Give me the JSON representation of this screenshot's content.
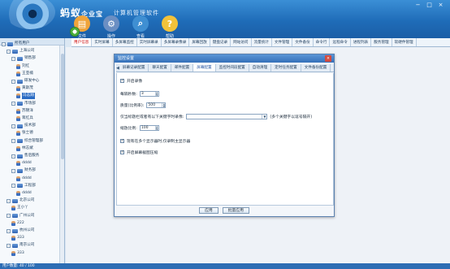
{
  "app": {
    "title": "蚂蚁企业宝",
    "title_suffix": "企业宝",
    "title_main": "蚂蚁",
    "subtitle": "计算机管理软件",
    "window_buttons": [
      "−",
      "□",
      "×"
    ]
  },
  "toolbar": {
    "items": [
      {
        "label": "文件",
        "icon": "folder-icon",
        "color": "#f0a43a"
      },
      {
        "label": "操作",
        "icon": "gear-icon",
        "color": "#6b8fc3"
      },
      {
        "label": "查看",
        "icon": "magnifier-icon",
        "color": "#3f8fd2"
      },
      {
        "label": "帮助",
        "icon": "help-icon",
        "color": "#f2c23a"
      }
    ]
  },
  "navbar": {
    "tabs": [
      "用户信息",
      "实时屏幕",
      "多屏幕监控",
      "实时屏幕录",
      "多屏幕录像录",
      "屏幕回放",
      "键盘记录",
      "网站访问",
      "流量统计",
      "文件管理",
      "文件备份",
      "命令行",
      "远程命令",
      "进程列表",
      "服务管理",
      "软硬件管理"
    ],
    "active_index": 0
  },
  "tree": {
    "nodes": [
      {
        "label": "所有用户",
        "type": "folder",
        "level": 0,
        "toggle": "-"
      },
      {
        "label": "上海公司",
        "type": "folder",
        "level": 1,
        "toggle": "-"
      },
      {
        "label": "销售部",
        "type": "folder",
        "level": 2,
        "toggle": "-"
      },
      {
        "label": "刘红",
        "type": "user",
        "level": 3
      },
      {
        "label": "王亚楠",
        "type": "user",
        "level": 3
      },
      {
        "label": "研发中心",
        "type": "folder",
        "level": 2,
        "toggle": "-"
      },
      {
        "label": "黄斯茂",
        "type": "user",
        "level": 3
      },
      {
        "label": "冯志翔",
        "type": "user",
        "level": 3,
        "selected": true
      },
      {
        "label": "市场部",
        "type": "folder",
        "level": 2,
        "toggle": "-"
      },
      {
        "label": "苏锦洋",
        "type": "user",
        "level": 3
      },
      {
        "label": "蒋红兵",
        "type": "user",
        "level": 3
      },
      {
        "label": "技术部",
        "type": "folder",
        "level": 2,
        "toggle": "-"
      },
      {
        "label": "张士德",
        "type": "user",
        "level": 3
      },
      {
        "label": "综合管理部",
        "type": "folder",
        "level": 2,
        "toggle": "-"
      },
      {
        "label": "林志斌",
        "type": "user",
        "level": 3
      },
      {
        "label": "售后服务",
        "type": "folder",
        "level": 2,
        "toggle": "-"
      },
      {
        "label": "dddd",
        "type": "user",
        "level": 3
      },
      {
        "label": "财务部",
        "type": "folder",
        "level": 2,
        "toggle": "-"
      },
      {
        "label": "dddd",
        "type": "user",
        "level": 3
      },
      {
        "label": "工程部",
        "type": "folder",
        "level": 2,
        "toggle": "-"
      },
      {
        "label": "dddd",
        "type": "user",
        "level": 3
      },
      {
        "label": "北京公司",
        "type": "folder",
        "level": 1,
        "toggle": "-"
      },
      {
        "label": "王小丫",
        "type": "user",
        "level": 2
      },
      {
        "label": "广州公司",
        "type": "folder",
        "level": 1,
        "toggle": "-"
      },
      {
        "label": "222",
        "type": "user",
        "level": 2
      },
      {
        "label": "杭州公司",
        "type": "folder",
        "level": 1,
        "toggle": "-"
      },
      {
        "label": "333",
        "type": "user",
        "level": 2
      },
      {
        "label": "南京公司",
        "type": "folder",
        "level": 1,
        "toggle": "-"
      },
      {
        "label": "333",
        "type": "user",
        "level": 2
      }
    ]
  },
  "status": {
    "text": "用户数量: 40 / 100"
  },
  "dialog": {
    "title": "监控设置",
    "close": "×",
    "tab_left": "◀",
    "tab_right": "▶",
    "tabs": [
      "屏幕记录配置",
      "聊天配置",
      "邮件配置",
      "屏幕配置",
      "监控时间段配置",
      "自动清理",
      "定时任务配置",
      "文件备份配置",
      "文件"
    ],
    "active_tab": 3,
    "enable_label": "开启录像",
    "enable_checked": "✓",
    "interval_label": "每隔秒数:",
    "interval_value": "3",
    "quality_label": "质量(比例率):",
    "quality_value": "500",
    "title_rule_label": "仅当标题栏或者有以下关键字时录像:",
    "title_rule_note": "(多个关键字以逗号隔开)",
    "ratio_label": "缩放比例:",
    "ratio_value": "100",
    "multi_label": "现有在多个显示器时,仅录制主显示器",
    "multi_checked": "✓",
    "compress_label": "开启屏幕截图压缩",
    "compress_checked": "✓",
    "apply": "应用",
    "batch": "批量应用",
    "spin_up": "▲",
    "spin_down": "▼",
    "dropdown": "▼"
  }
}
